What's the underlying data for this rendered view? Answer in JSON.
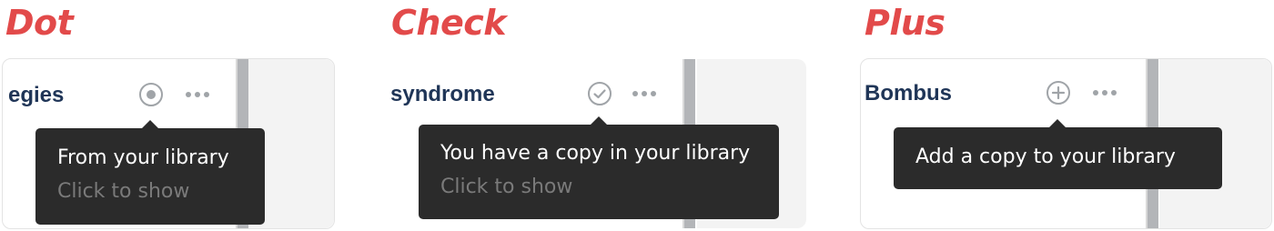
{
  "panels": [
    {
      "heading": "Dot",
      "title": "egies",
      "icon": "dot-circle-icon",
      "tooltip": {
        "primary": "From your library",
        "secondary": "Click to show"
      }
    },
    {
      "heading": "Check",
      "title": "syndrome",
      "icon": "check-circle-icon",
      "tooltip": {
        "primary": "You have a copy in your library",
        "secondary": "Click to show"
      }
    },
    {
      "heading": "Plus",
      "title": "Bombus",
      "icon": "plus-circle-icon",
      "tooltip": {
        "primary": "Add a copy to your library",
        "secondary": ""
      }
    }
  ],
  "more_icon": "more-horizontal-icon",
  "colors": {
    "heading": "#e24a4a",
    "title": "#1f3557",
    "tooltip_bg": "#2b2b2b",
    "tooltip_secondary": "#7a7a7a",
    "icon": "#a0a4a8"
  }
}
